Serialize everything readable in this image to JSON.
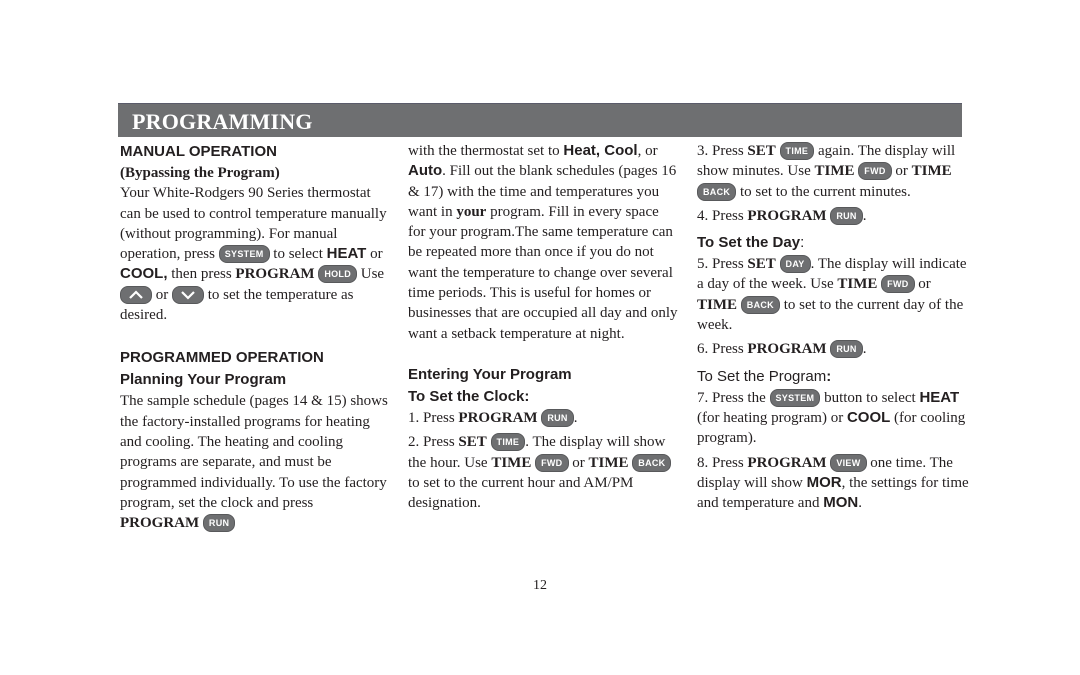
{
  "header": {
    "title": "PROGRAMMING"
  },
  "col1": {
    "manual_heading": "MANUAL OPERATION",
    "manual_subheading": "(Bypassing the Program)",
    "manual_text_1": "Your White-Rodgers 90 Series thermostat can be used to control temperature manually (without programming). For manual operation, press",
    "key_system": "SYSTEM",
    "manual_text_2": "to select",
    "heat": "HEAT",
    "or": "or",
    "cool": "COOL,",
    "manual_text_3": "then press",
    "program": "PROGRAM",
    "key_hold": "HOLD",
    "use": "Use",
    "up_icon": "up-arrow-icon",
    "down_icon": "down-arrow-icon",
    "manual_text_4": "to set the temperature as desired.",
    "programmed_heading": "PROGRAMMED OPERATION",
    "planning_heading": "Planning Your Program",
    "planning_text": "The sample schedule (pages 14 & 15) shows the factory-installed programs for heating and cooling. The heating and cooling programs are separate, and must be programmed individually. To use the factory program, set the clock and press",
    "key_run": "RUN"
  },
  "col2": {
    "text_1": "with the thermostat set to",
    "heat_cool": "Heat, Cool",
    "comma_or": ", or",
    "auto": "Auto",
    "text_2": ". Fill out the blank schedules (pages 16 & 17) with the time and temperatures you want in",
    "your": "your",
    "text_3": "program. Fill in every space for your program.The same temperature can be repeated more than once if you do not want the temperature to change over several time periods. This is useful for homes or businesses that are occupied all day and only want a setback temperature at night.",
    "entering_heading": "Entering Your Program",
    "clock_heading": "To Set the Clock:",
    "step1_prefix": "1.  Press",
    "step1_program": "PROGRAM",
    "step1_key": "RUN",
    "step2_prefix": "2.  Press",
    "step2_set": "SET",
    "step2_key": "TIME",
    "step2_text_1": ". The display will show the hour. Use",
    "time_word": "TIME",
    "key_fwd": "FWD",
    "or": "or",
    "key_back": "BACK",
    "step2_text_2": "to set to the current hour and AM/PM designation."
  },
  "col3": {
    "step3_prefix": "3.  Press",
    "set": "SET",
    "key_time": "TIME",
    "step3_text_1": "again. The display will show minutes. Use",
    "time_word": "TIME",
    "key_fwd": "FWD",
    "or": "or",
    "key_back": "BACK",
    "step3_text_2": "to set to the current minutes.",
    "step4_prefix": "4.  Press",
    "program": "PROGRAM",
    "key_run": "RUN",
    "day_heading": "To Set the Day",
    "colon": ":",
    "step5_prefix": "5.  Press",
    "key_day": "DAY",
    "step5_text_1": ". The display will indicate a day of the week. Use",
    "step5_text_2": "to set to the current day of the week.",
    "step6_prefix": "6.  Press",
    "program_heading": "To Set the Program",
    "step7_prefix": "7.  Press the",
    "key_system": "SYSTEM",
    "step7_text_1": "button to select",
    "heat": "HEAT",
    "step7_text_2": "(for heating program) or",
    "cool": "COOL",
    "step7_text_3": "(for cooling program).",
    "step8_prefix": "8.  Press",
    "key_view": "VIEW",
    "step8_text_1": "one time. The display will show",
    "mor": "MOR",
    "step8_text_2": ", the settings for time and temperature and",
    "mon": "MON",
    "period": "."
  },
  "footer": {
    "page_number": "12"
  }
}
